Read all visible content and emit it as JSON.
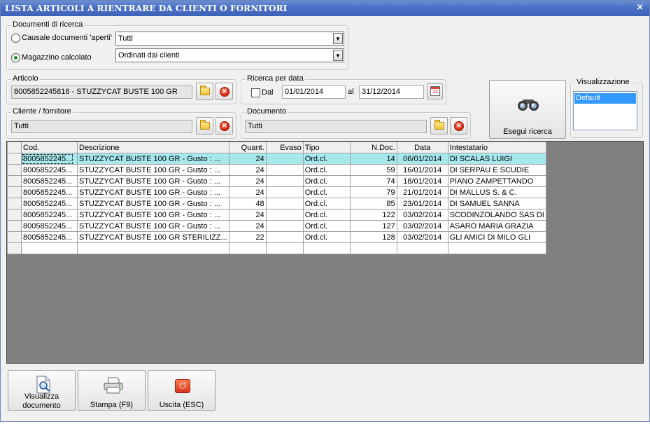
{
  "window": {
    "title": "LISTA ARTICOLI A RIENTRARE DA CLIENTI O FORNITORI",
    "close_glyph": "×"
  },
  "documenti_ricerca": {
    "legend": "Documenti di ricerca",
    "causale_label": "Causale documenti 'aperti'",
    "causale_value": "Tutti",
    "causale_selected": false,
    "magazzino_label": "Magazzino calcolato",
    "magazzino_value": "Ordinati dai clienti",
    "magazzino_selected": true
  },
  "articolo": {
    "legend": "Articolo",
    "value": "8005852245816 - STUZZYCAT BUSTE 100 GR"
  },
  "ricerca_data": {
    "legend": "Ricerca per data",
    "dal_label": "Dal",
    "dal_checked": false,
    "dal_value": "01/01/2014",
    "al_label": "al",
    "al_value": "31/12/2014",
    "calendar_text": "12"
  },
  "cliente_fornitore": {
    "legend": "Cliente / fornitore",
    "value": "Tutti"
  },
  "documento": {
    "legend": "Documento",
    "value": "Tutti"
  },
  "esegui_ricerca": {
    "label": "Esegui ricerca",
    "icon": "binoculars-icon"
  },
  "visualizzazione": {
    "legend": "Visualizzazione",
    "selected": "Default"
  },
  "grid": {
    "columns": [
      "Cod.",
      "Descrizione",
      "Quant.",
      "Evaso",
      "Tipo",
      "N.Doc.",
      "Data",
      "Intestatario"
    ],
    "rows": [
      {
        "cod": "8005852245...",
        "descrizione": "STUZZYCAT BUSTE 100 GR  - Gusto : ...",
        "quant": "24",
        "evaso": "",
        "tipo": "Ord.cl.",
        "ndoc": "14",
        "data": "06/01/2014",
        "intestatario": "DI SCALAS LUIGI"
      },
      {
        "cod": "8005852245...",
        "descrizione": "STUZZYCAT BUSTE 100 GR  - Gusto : ...",
        "quant": "24",
        "evaso": "",
        "tipo": "Ord.cl.",
        "ndoc": "59",
        "data": "16/01/2014",
        "intestatario": "DI SERPAU E SCUDIE"
      },
      {
        "cod": "8005852245...",
        "descrizione": "STUZZYCAT BUSTE 100 GR  - Gusto : ...",
        "quant": "24",
        "evaso": "",
        "tipo": "Ord.cl.",
        "ndoc": "74",
        "data": "18/01/2014",
        "intestatario": "PIANO ZAMPETTANDO"
      },
      {
        "cod": "8005852245...",
        "descrizione": "STUZZYCAT BUSTE 100 GR  - Gusto : ...",
        "quant": "24",
        "evaso": "",
        "tipo": "Ord.cl.",
        "ndoc": "79",
        "data": "21/01/2014",
        "intestatario": "DI MALLUS S. & C."
      },
      {
        "cod": "8005852245...",
        "descrizione": "STUZZYCAT BUSTE 100 GR  - Gusto : ...",
        "quant": "48",
        "evaso": "",
        "tipo": "Ord.cl.",
        "ndoc": "85",
        "data": "23/01/2014",
        "intestatario": "DI SAMUEL SANNA"
      },
      {
        "cod": "8005852245...",
        "descrizione": "STUZZYCAT BUSTE 100 GR  - Gusto : ...",
        "quant": "24",
        "evaso": "",
        "tipo": "Ord.cl.",
        "ndoc": "122",
        "data": "03/02/2014",
        "intestatario": "SCODINZOLANDO SAS DI"
      },
      {
        "cod": "8005852245...",
        "descrizione": "STUZZYCAT BUSTE 100 GR  - Gusto : ...",
        "quant": "24",
        "evaso": "",
        "tipo": "Ord.cl.",
        "ndoc": "127",
        "data": "03/02/2014",
        "intestatario": "ASARO MARIA GRAZIA"
      },
      {
        "cod": "8005852245...",
        "descrizione": "STUZZYCAT BUSTE 100 GR STERILIZZ...",
        "quant": "22",
        "evaso": "",
        "tipo": "Ord.cl.",
        "ndoc": "128",
        "data": "03/02/2014",
        "intestatario": "GLI AMICI DI MILO GLI"
      },
      {
        "cod": "",
        "descrizione": "",
        "quant": "",
        "evaso": "",
        "tipo": "",
        "ndoc": "",
        "data": "",
        "intestatario": ""
      }
    ],
    "selected_row": 0,
    "selected_row_color": "#a6e8ec",
    "background_color": "#808080"
  },
  "footer_buttons": [
    {
      "label_line1": "Visualizza",
      "label_line2": "documento",
      "icon": "document-search-icon"
    },
    {
      "label_line1": "Stampa (F9)",
      "label_line2": "",
      "icon": "printer-icon"
    },
    {
      "label_line1": "Uscita (ESC)",
      "label_line2": "",
      "icon": "exit-icon"
    }
  ],
  "colors": {
    "titlebar": "#4a6fc4",
    "window_bg": "#f0f0f0",
    "accent_selected": "#3399ff"
  }
}
